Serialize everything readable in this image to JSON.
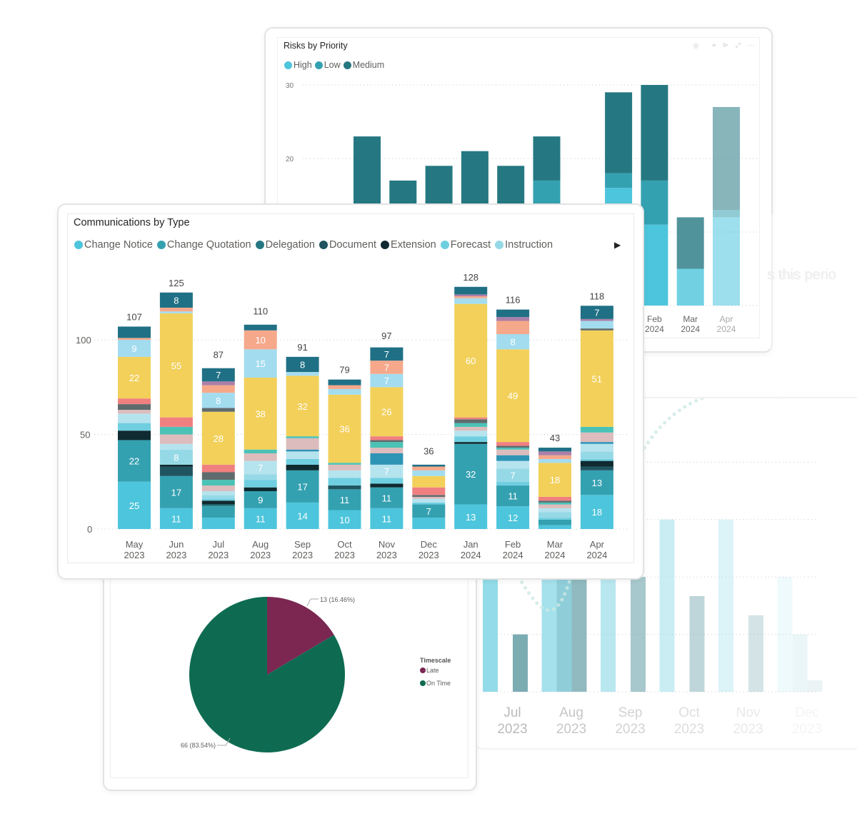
{
  "risks_card": {
    "title": "Risks by Priority",
    "icons": [
      "help-icon",
      "filter-icon",
      "focus-icon",
      "expand-icon",
      "more-icon"
    ],
    "icon_glyphs": [
      "⓪",
      "⩧",
      "⊳",
      "⤢",
      "⋯"
    ]
  },
  "background_text": "s this perio",
  "communications_card": {
    "title": "Communications by Type",
    "legend_next_glyph": "▶"
  },
  "timescale_card": {
    "legend_title": "Timescale"
  },
  "right_chart": {
    "x_labels": [
      [
        "Jul",
        "2023"
      ],
      [
        "Aug",
        "2023"
      ],
      [
        "Sep",
        "2023"
      ],
      [
        "Oct",
        "2023"
      ],
      [
        "Nov",
        "2023"
      ],
      [
        "Dec",
        "2023"
      ]
    ]
  },
  "chart_data": [
    {
      "id": "risks",
      "type": "bar",
      "stacked": true,
      "title": "Risks by Priority",
      "categories_visible": [
        [
          "Feb",
          "2024"
        ],
        [
          "Mar",
          "2024"
        ],
        [
          "Apr",
          "2024"
        ]
      ],
      "legend": [
        {
          "name": "High",
          "color": "#4dc5dc"
        },
        {
          "name": "Low",
          "color": "#34a1b1"
        },
        {
          "name": "Medium",
          "color": "#257882"
        }
      ],
      "yticks": [
        20,
        30
      ],
      "ylim": [
        0,
        30
      ],
      "grid": true,
      "bars": [
        {
          "high": 0,
          "low": 0,
          "medium": 23
        },
        {
          "high": 0,
          "low": 0,
          "medium": 17
        },
        {
          "high": 0,
          "low": 0.3,
          "medium": 18.7
        },
        {
          "high": 0,
          "low": 0,
          "medium": 21
        },
        {
          "high": 0,
          "low": 0.3,
          "medium": 18.7
        },
        {
          "high": 0,
          "low": 17,
          "medium": 6
        },
        null,
        {
          "high": 16,
          "low": 2,
          "medium": 11
        },
        {
          "high": 11,
          "low": 6,
          "medium": 13
        },
        {
          "high": 5,
          "low": 0,
          "medium": 7
        },
        {
          "high": 12,
          "low": 1,
          "medium": 14
        }
      ]
    },
    {
      "id": "communications",
      "type": "bar",
      "stacked": true,
      "title": "Communications by Type",
      "xlabel": "",
      "ylabel": "",
      "ylim": [
        0,
        130
      ],
      "yticks": [
        0,
        50,
        100
      ],
      "grid": true,
      "legend_position": "top-left",
      "legend": [
        {
          "name": "Change Notice",
          "color": "#4dc5dc"
        },
        {
          "name": "Change Quotation",
          "color": "#34a1b1"
        },
        {
          "name": "Delegation",
          "color": "#257882"
        },
        {
          "name": "Document",
          "color": "#1f5460"
        },
        {
          "name": "Extension",
          "color": "#0f2a30"
        },
        {
          "name": "Forecast",
          "color": "#6fcfe0"
        },
        {
          "name": "Instruction",
          "color": "#96d9e6"
        }
      ],
      "segment_colors": {
        "cn": "#4dc5dc",
        "cq": "#34a1b1",
        "dl": "#257882",
        "doc": "#1f5460",
        "ext": "#0f2a30",
        "fc": "#6fcfe0",
        "ins": "#96d9e6",
        "lb": "#b5e3ee",
        "pk": "#dcbcbc",
        "tq": "#4ac2b6",
        "gr": "#5f6b6d",
        "rd": "#f08080",
        "yl": "#f2d05a",
        "sk": "#a3dcef",
        "pe": "#f6a88b",
        "pu": "#ab7fa8",
        "tl": "#207085",
        "bl": "#2e94b6"
      },
      "categories": [
        [
          "May",
          "2023"
        ],
        [
          "Jun",
          "2023"
        ],
        [
          "Jul",
          "2023"
        ],
        [
          "Aug",
          "2023"
        ],
        [
          "Sep",
          "2023"
        ],
        [
          "Oct",
          "2023"
        ],
        [
          "Nov",
          "2023"
        ],
        [
          "Dec",
          "2023"
        ],
        [
          "Jan",
          "2024"
        ],
        [
          "Feb",
          "2024"
        ],
        [
          "Mar",
          "2024"
        ],
        [
          "Apr",
          "2024"
        ]
      ],
      "totals": [
        107,
        125,
        87,
        110,
        91,
        79,
        97,
        36,
        128,
        116,
        43,
        118
      ],
      "stacks": [
        [
          [
            "cn",
            25,
            true
          ],
          [
            "cq",
            22,
            true
          ],
          [
            "ext",
            5
          ],
          [
            "fc",
            4
          ],
          [
            "lb",
            5
          ],
          [
            "pk",
            2
          ],
          [
            "gr",
            3
          ],
          [
            "rd",
            3
          ],
          [
            "yl",
            22,
            true
          ],
          [
            "sk",
            9,
            true
          ],
          [
            "pe",
            1
          ],
          [
            "tl",
            6
          ]
        ],
        [
          [
            "cn",
            11,
            true
          ],
          [
            "cq",
            17,
            true
          ],
          [
            "doc",
            5
          ],
          [
            "ext",
            1
          ],
          [
            "ins",
            8,
            true
          ],
          [
            "lb",
            3
          ],
          [
            "pk",
            5
          ],
          [
            "tq",
            4
          ],
          [
            "rd",
            5
          ],
          [
            "yl",
            55,
            true
          ],
          [
            "sk",
            1
          ],
          [
            "pe",
            2
          ],
          [
            "tl",
            8,
            true
          ]
        ],
        [
          [
            "cn",
            6
          ],
          [
            "cq",
            6
          ],
          [
            "dl",
            1
          ],
          [
            "ext",
            2
          ],
          [
            "fc",
            1
          ],
          [
            "ins",
            2
          ],
          [
            "lb",
            2
          ],
          [
            "pk",
            3
          ],
          [
            "tq",
            3
          ],
          [
            "gr",
            4
          ],
          [
            "rd",
            4
          ],
          [
            "yl",
            28,
            true
          ],
          [
            "gr",
            2
          ],
          [
            "sk",
            8,
            true
          ],
          [
            "pe",
            4
          ],
          [
            "pu",
            2
          ],
          [
            "tl",
            7,
            true
          ]
        ],
        [
          [
            "cn",
            11,
            true
          ],
          [
            "cq",
            9,
            true
          ],
          [
            "ext",
            2
          ],
          [
            "fc",
            4
          ],
          [
            "ins",
            3
          ],
          [
            "lb",
            7,
            true
          ],
          [
            "pk",
            4
          ],
          [
            "tq",
            2
          ],
          [
            "yl",
            38,
            true
          ],
          [
            "sk",
            15,
            true
          ],
          [
            "pe",
            10,
            true
          ],
          [
            "tl",
            3
          ]
        ],
        [
          [
            "cn",
            14,
            true
          ],
          [
            "cq",
            17,
            true
          ],
          [
            "ext",
            3
          ],
          [
            "fc",
            3
          ],
          [
            "lb",
            4
          ],
          [
            "bl",
            1
          ],
          [
            "pk",
            6
          ],
          [
            "tq",
            1
          ],
          [
            "yl",
            32,
            true
          ],
          [
            "sk",
            2
          ],
          [
            "tl",
            8,
            true
          ]
        ],
        [
          [
            "cn",
            10,
            true
          ],
          [
            "cq",
            11,
            true
          ],
          [
            "doc",
            2
          ],
          [
            "fc",
            4
          ],
          [
            "lb",
            4
          ],
          [
            "pk",
            3
          ],
          [
            "tq",
            1
          ],
          [
            "yl",
            36,
            true
          ],
          [
            "sk",
            3
          ],
          [
            "pe",
            2
          ],
          [
            "tl",
            3
          ]
        ],
        [
          [
            "cn",
            11,
            true
          ],
          [
            "cq",
            11,
            true
          ],
          [
            "ext",
            2
          ],
          [
            "fc",
            3
          ],
          [
            "lb",
            7,
            true
          ],
          [
            "bl",
            6
          ],
          [
            "pk",
            3
          ],
          [
            "tq",
            3
          ],
          [
            "gr",
            1
          ],
          [
            "rd",
            2
          ],
          [
            "yl",
            26,
            true
          ],
          [
            "sk",
            7,
            true
          ],
          [
            "pe",
            7,
            true
          ],
          [
            "tl",
            7,
            true
          ]
        ],
        [
          [
            "cn",
            6
          ],
          [
            "cq",
            7,
            true
          ],
          [
            "fc",
            1
          ],
          [
            "lb",
            2
          ],
          [
            "pk",
            1
          ],
          [
            "gr",
            1
          ],
          [
            "rd",
            4
          ],
          [
            "yl",
            6
          ],
          [
            "sk",
            3
          ],
          [
            "pe",
            2
          ],
          [
            "tl",
            1
          ]
        ],
        [
          [
            "cn",
            13,
            true
          ],
          [
            "cq",
            32,
            true
          ],
          [
            "ext",
            1
          ],
          [
            "fc",
            3
          ],
          [
            "lb",
            3
          ],
          [
            "pk",
            2
          ],
          [
            "tq",
            2
          ],
          [
            "gr",
            2
          ],
          [
            "rd",
            1
          ],
          [
            "yl",
            60,
            true
          ],
          [
            "sk",
            3
          ],
          [
            "pe",
            1
          ],
          [
            "pu",
            1
          ],
          [
            "tl",
            4
          ]
        ],
        [
          [
            "cn",
            12,
            true
          ],
          [
            "cq",
            11,
            true
          ],
          [
            "fc",
            2
          ],
          [
            "ins",
            7,
            true
          ],
          [
            "lb",
            4
          ],
          [
            "bl",
            3
          ],
          [
            "pk",
            3
          ],
          [
            "tq",
            1
          ],
          [
            "gr",
            1
          ],
          [
            "rd",
            2
          ],
          [
            "yl",
            49,
            true
          ],
          [
            "sk",
            8,
            true
          ],
          [
            "pe",
            7
          ],
          [
            "pu",
            2
          ],
          [
            "tl",
            4
          ]
        ],
        [
          [
            "cn",
            2
          ],
          [
            "cq",
            3
          ],
          [
            "fc",
            1
          ],
          [
            "ins",
            3
          ],
          [
            "lb",
            2
          ],
          [
            "pk",
            2
          ],
          [
            "tq",
            1
          ],
          [
            "gr",
            1
          ],
          [
            "rd",
            2
          ],
          [
            "yl",
            18,
            true
          ],
          [
            "sk",
            2
          ],
          [
            "pe",
            2
          ],
          [
            "pu",
            2
          ],
          [
            "tl",
            2
          ]
        ],
        [
          [
            "cn",
            18,
            true
          ],
          [
            "cq",
            13,
            true
          ],
          [
            "doc",
            2
          ],
          [
            "ext",
            3
          ],
          [
            "fc",
            1
          ],
          [
            "ins",
            4
          ],
          [
            "lb",
            4
          ],
          [
            "bl",
            1
          ],
          [
            "pk",
            5
          ],
          [
            "tq",
            3
          ],
          [
            "yl",
            51,
            true
          ],
          [
            "gr",
            1
          ],
          [
            "sk",
            4
          ],
          [
            "pu",
            1
          ],
          [
            "tl",
            7,
            true
          ]
        ]
      ]
    },
    {
      "id": "timescale",
      "type": "pie",
      "title": "",
      "legend_title": "Timescale",
      "legend_position": "right",
      "slices": [
        {
          "name": "Late",
          "value": 13,
          "percent": 16.46,
          "label": "13 (16.46%)",
          "color": "#7b2752"
        },
        {
          "name": "On Time",
          "value": 66,
          "percent": 83.54,
          "label": "66 (83.54%)",
          "color": "#0e6b52"
        }
      ]
    },
    {
      "id": "background-bars",
      "type": "bar",
      "title": "",
      "categories": [
        "Jul 2023",
        "Aug 2023",
        "Sep 2023",
        "Oct 2023",
        "Nov 2023",
        "Dec 2023"
      ],
      "series": [
        {
          "name": "series-a",
          "values": [
            9,
            9,
            9,
            9,
            9,
            6
          ]
        },
        {
          "name": "series-b",
          "values": [
            3,
            1.8,
            6,
            5,
            4,
            0.6
          ]
        },
        {
          "name": "series-c",
          "values": [
            0,
            7.5,
            0,
            0,
            0,
            3
          ]
        }
      ]
    }
  ]
}
